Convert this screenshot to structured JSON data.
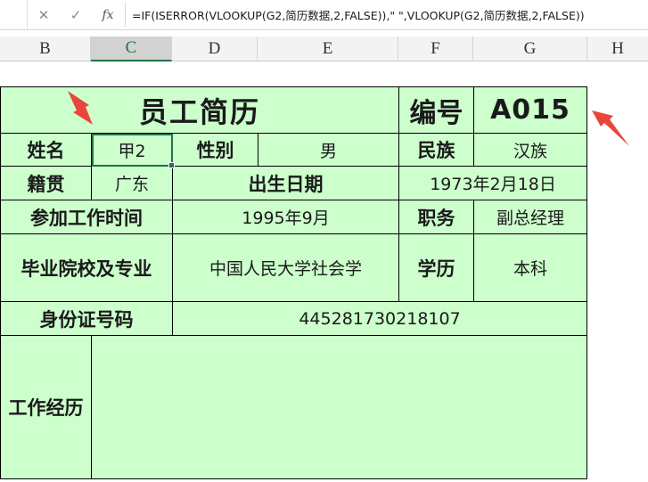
{
  "formula_bar": {
    "cancel_icon": "close-icon",
    "enter_icon": "check-icon",
    "fx_label": "fx",
    "formula": "=IF(ISERROR(VLOOKUP(G2,简历数据,2,FALSE)),\" \",VLOOKUP(G2,简历数据,2,FALSE))"
  },
  "columns": [
    "B",
    "C",
    "D",
    "E",
    "F",
    "G",
    "H"
  ],
  "selected_column": "C",
  "sheet": {
    "title": "员工简历",
    "id_label": "编号",
    "id_value": "A015",
    "name_label": "姓名",
    "name_value": "甲2",
    "gender_label": "性别",
    "gender_value": "男",
    "ethnicity_label": "民族",
    "ethnicity_value": "汉族",
    "native_label": "籍贯",
    "native_value": "广东",
    "birth_label": "出生日期",
    "birth_value": "1973年2月18日",
    "join_label": "参加工作时间",
    "join_value": "1995年9月",
    "position_label": "职务",
    "position_value": "副总经理",
    "school_label": "毕业院校及专业",
    "school_value": "中国人民大学社会学",
    "education_label": "学历",
    "education_value": "本科",
    "idcard_label": "身份证号码",
    "idcard_value": "445281730218107",
    "experience_label": "工作经历",
    "experience_value": ""
  },
  "colors": {
    "cell_fill": "#ccffcc",
    "selection": "#217346",
    "arrow": "#e8463a"
  }
}
